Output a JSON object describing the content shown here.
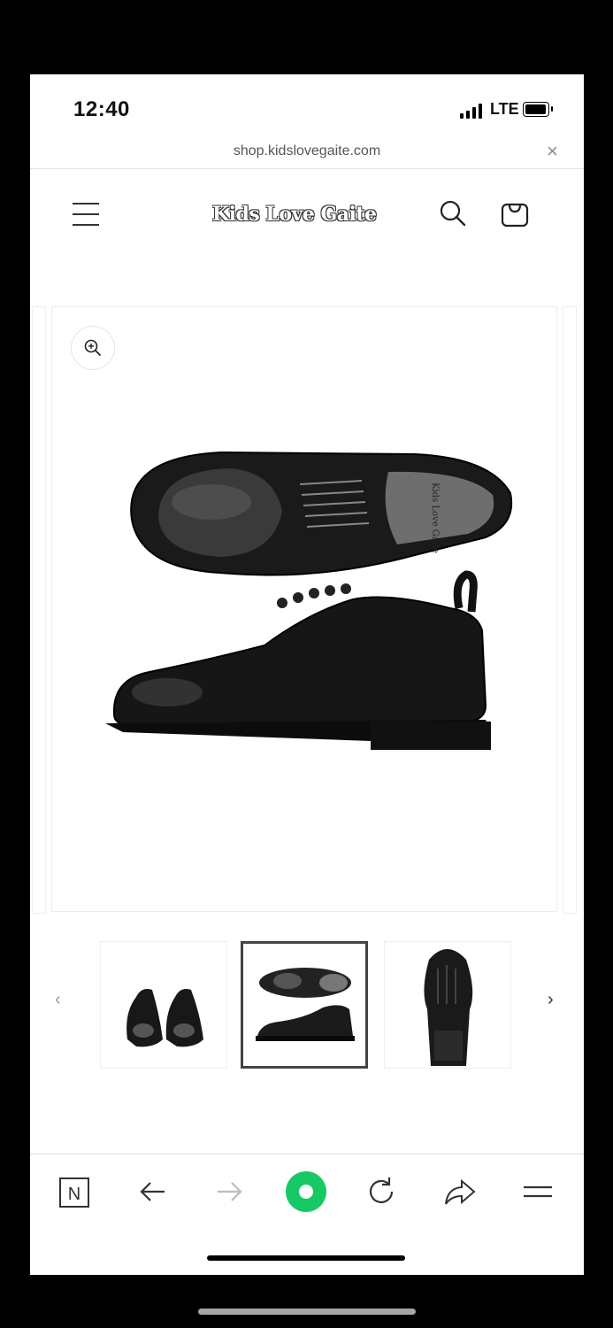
{
  "status_bar": {
    "time": "12:40",
    "network": "LTE"
  },
  "browser": {
    "url": "shop.kidslovegaite.com",
    "close_label": "×"
  },
  "store": {
    "logo_text": "Kids Love Gaite"
  },
  "product": {
    "insole_text": "Kids Love Gaite",
    "thumbnails": [
      {
        "name": "thumb-front-pair"
      },
      {
        "name": "thumb-top-side"
      },
      {
        "name": "thumb-sole"
      }
    ],
    "prev_label": "‹",
    "next_label": "›"
  },
  "colors": {
    "accent_green": "#17c964",
    "text": "#121212",
    "muted": "#555555"
  },
  "icons": [
    "menu-icon",
    "search-icon",
    "cart-icon",
    "zoom-icon",
    "n-icon",
    "back-icon",
    "forward-icon",
    "home-icon",
    "reload-icon",
    "share-icon",
    "tabs-menu-icon"
  ]
}
